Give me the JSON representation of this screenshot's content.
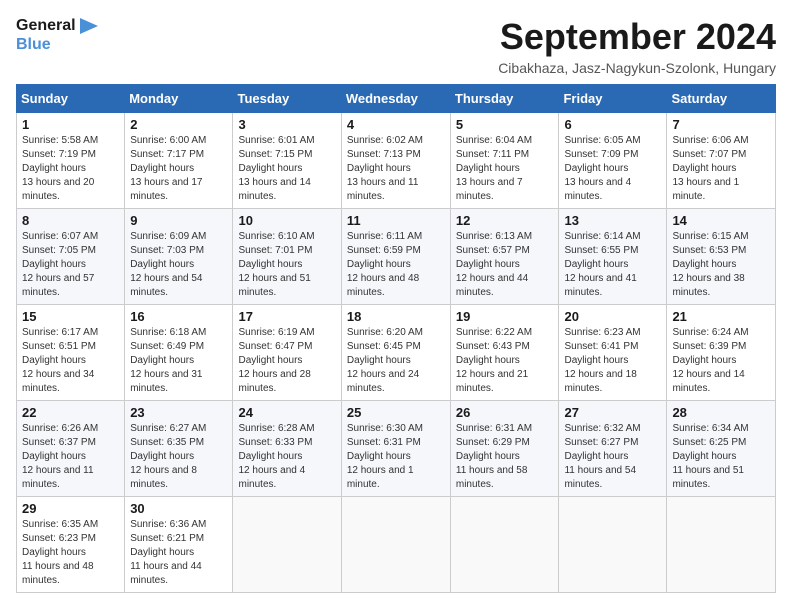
{
  "header": {
    "logo_line1": "General",
    "logo_line2": "Blue",
    "month_title": "September 2024",
    "location": "Cibakhaza, Jasz-Nagykun-Szolonk, Hungary"
  },
  "weekdays": [
    "Sunday",
    "Monday",
    "Tuesday",
    "Wednesday",
    "Thursday",
    "Friday",
    "Saturday"
  ],
  "weeks": [
    [
      {
        "day": "1",
        "sunrise": "Sunrise: 5:58 AM",
        "sunset": "Sunset: 7:19 PM",
        "daylight": "Daylight: 13 hours and 20 minutes."
      },
      {
        "day": "2",
        "sunrise": "Sunrise: 6:00 AM",
        "sunset": "Sunset: 7:17 PM",
        "daylight": "Daylight: 13 hours and 17 minutes."
      },
      {
        "day": "3",
        "sunrise": "Sunrise: 6:01 AM",
        "sunset": "Sunset: 7:15 PM",
        "daylight": "Daylight: 13 hours and 14 minutes."
      },
      {
        "day": "4",
        "sunrise": "Sunrise: 6:02 AM",
        "sunset": "Sunset: 7:13 PM",
        "daylight": "Daylight: 13 hours and 11 minutes."
      },
      {
        "day": "5",
        "sunrise": "Sunrise: 6:04 AM",
        "sunset": "Sunset: 7:11 PM",
        "daylight": "Daylight: 13 hours and 7 minutes."
      },
      {
        "day": "6",
        "sunrise": "Sunrise: 6:05 AM",
        "sunset": "Sunset: 7:09 PM",
        "daylight": "Daylight: 13 hours and 4 minutes."
      },
      {
        "day": "7",
        "sunrise": "Sunrise: 6:06 AM",
        "sunset": "Sunset: 7:07 PM",
        "daylight": "Daylight: 13 hours and 1 minute."
      }
    ],
    [
      {
        "day": "8",
        "sunrise": "Sunrise: 6:07 AM",
        "sunset": "Sunset: 7:05 PM",
        "daylight": "Daylight: 12 hours and 57 minutes."
      },
      {
        "day": "9",
        "sunrise": "Sunrise: 6:09 AM",
        "sunset": "Sunset: 7:03 PM",
        "daylight": "Daylight: 12 hours and 54 minutes."
      },
      {
        "day": "10",
        "sunrise": "Sunrise: 6:10 AM",
        "sunset": "Sunset: 7:01 PM",
        "daylight": "Daylight: 12 hours and 51 minutes."
      },
      {
        "day": "11",
        "sunrise": "Sunrise: 6:11 AM",
        "sunset": "Sunset: 6:59 PM",
        "daylight": "Daylight: 12 hours and 48 minutes."
      },
      {
        "day": "12",
        "sunrise": "Sunrise: 6:13 AM",
        "sunset": "Sunset: 6:57 PM",
        "daylight": "Daylight: 12 hours and 44 minutes."
      },
      {
        "day": "13",
        "sunrise": "Sunrise: 6:14 AM",
        "sunset": "Sunset: 6:55 PM",
        "daylight": "Daylight: 12 hours and 41 minutes."
      },
      {
        "day": "14",
        "sunrise": "Sunrise: 6:15 AM",
        "sunset": "Sunset: 6:53 PM",
        "daylight": "Daylight: 12 hours and 38 minutes."
      }
    ],
    [
      {
        "day": "15",
        "sunrise": "Sunrise: 6:17 AM",
        "sunset": "Sunset: 6:51 PM",
        "daylight": "Daylight: 12 hours and 34 minutes."
      },
      {
        "day": "16",
        "sunrise": "Sunrise: 6:18 AM",
        "sunset": "Sunset: 6:49 PM",
        "daylight": "Daylight: 12 hours and 31 minutes."
      },
      {
        "day": "17",
        "sunrise": "Sunrise: 6:19 AM",
        "sunset": "Sunset: 6:47 PM",
        "daylight": "Daylight: 12 hours and 28 minutes."
      },
      {
        "day": "18",
        "sunrise": "Sunrise: 6:20 AM",
        "sunset": "Sunset: 6:45 PM",
        "daylight": "Daylight: 12 hours and 24 minutes."
      },
      {
        "day": "19",
        "sunrise": "Sunrise: 6:22 AM",
        "sunset": "Sunset: 6:43 PM",
        "daylight": "Daylight: 12 hours and 21 minutes."
      },
      {
        "day": "20",
        "sunrise": "Sunrise: 6:23 AM",
        "sunset": "Sunset: 6:41 PM",
        "daylight": "Daylight: 12 hours and 18 minutes."
      },
      {
        "day": "21",
        "sunrise": "Sunrise: 6:24 AM",
        "sunset": "Sunset: 6:39 PM",
        "daylight": "Daylight: 12 hours and 14 minutes."
      }
    ],
    [
      {
        "day": "22",
        "sunrise": "Sunrise: 6:26 AM",
        "sunset": "Sunset: 6:37 PM",
        "daylight": "Daylight: 12 hours and 11 minutes."
      },
      {
        "day": "23",
        "sunrise": "Sunrise: 6:27 AM",
        "sunset": "Sunset: 6:35 PM",
        "daylight": "Daylight: 12 hours and 8 minutes."
      },
      {
        "day": "24",
        "sunrise": "Sunrise: 6:28 AM",
        "sunset": "Sunset: 6:33 PM",
        "daylight": "Daylight: 12 hours and 4 minutes."
      },
      {
        "day": "25",
        "sunrise": "Sunrise: 6:30 AM",
        "sunset": "Sunset: 6:31 PM",
        "daylight": "Daylight: 12 hours and 1 minute."
      },
      {
        "day": "26",
        "sunrise": "Sunrise: 6:31 AM",
        "sunset": "Sunset: 6:29 PM",
        "daylight": "Daylight: 11 hours and 58 minutes."
      },
      {
        "day": "27",
        "sunrise": "Sunrise: 6:32 AM",
        "sunset": "Sunset: 6:27 PM",
        "daylight": "Daylight: 11 hours and 54 minutes."
      },
      {
        "day": "28",
        "sunrise": "Sunrise: 6:34 AM",
        "sunset": "Sunset: 6:25 PM",
        "daylight": "Daylight: 11 hours and 51 minutes."
      }
    ],
    [
      {
        "day": "29",
        "sunrise": "Sunrise: 6:35 AM",
        "sunset": "Sunset: 6:23 PM",
        "daylight": "Daylight: 11 hours and 48 minutes."
      },
      {
        "day": "30",
        "sunrise": "Sunrise: 6:36 AM",
        "sunset": "Sunset: 6:21 PM",
        "daylight": "Daylight: 11 hours and 44 minutes."
      },
      null,
      null,
      null,
      null,
      null
    ]
  ]
}
